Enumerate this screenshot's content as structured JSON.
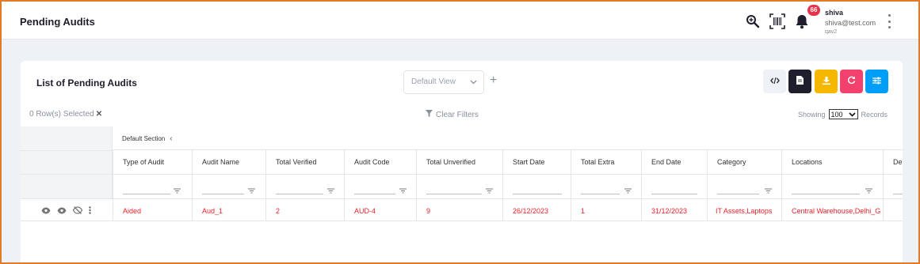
{
  "header": {
    "title": "Pending Audits",
    "notification_count": "66",
    "user": {
      "name": "shiva",
      "email": "shiva@test.com",
      "org": "qav2"
    }
  },
  "card": {
    "title": "List of Pending Audits",
    "view_select": "Default View",
    "rows_selected": "0 Row(s) Selected",
    "clear_filters": "Clear Filters",
    "showing_label": "Showing",
    "page_size": "100",
    "records_label": "Records",
    "actions": [
      {
        "icon": "code-icon",
        "color": "#eef1f5"
      },
      {
        "icon": "document-icon",
        "color": "#1e1e2d"
      },
      {
        "icon": "download-icon",
        "color": "#f5b700"
      },
      {
        "icon": "refresh-icon",
        "color": "#f1416c"
      },
      {
        "icon": "settings-sliders-icon",
        "color": "#009ef7"
      }
    ]
  },
  "table": {
    "section_label": "Default Section",
    "columns": [
      "Type of Audit",
      "Audit Name",
      "Total Verified",
      "Audit Code",
      "Total Unverified",
      "Start Date",
      "Total Extra",
      "End Date",
      "Category",
      "Locations",
      "Dep"
    ],
    "rows": [
      [
        "Aided",
        "Aud_1",
        "2",
        "AUD-4",
        "9",
        "26/12/2023",
        "1",
        "31/12/2023",
        "IT Assets,Laptops",
        "Central Warehouse,Delhi_G",
        ""
      ]
    ]
  },
  "colors": {
    "accent_red": "#e8232a",
    "badge": "#e8324a",
    "frame_border": "#e07b2a"
  }
}
